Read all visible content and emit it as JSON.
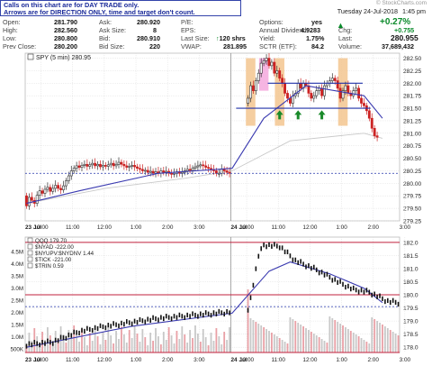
{
  "notice": {
    "line1": "Calls on this chart are for DAY TRADE only.",
    "line2": "Arrows are for DIRECTION ONLY, time and target don't count."
  },
  "header": {
    "date": "Tuesday 24-Jul-2018",
    "time": "1:45 pm",
    "watermark": "© StockCharts.com",
    "change_pct": "+0.27%"
  },
  "quote": {
    "open_label": "Open:",
    "open": "281.790",
    "high_label": "High:",
    "high": "282.560",
    "low_label": "Low:",
    "low": "280.800",
    "prev_label": "Prev Close:",
    "prev": "280.200",
    "ask_label": "Ask:",
    "ask": "280.920",
    "asksize_label": "Ask Size:",
    "asksize": "8",
    "bid_label": "Bid:",
    "bid": "280.910",
    "bidsize_label": "Bid Size:",
    "bidsize": "220",
    "pe_label": "P/E:",
    "eps_label": "EPS:",
    "lastsize_label": "Last Size:",
    "lastsize": "120 shrs",
    "vwap_label": "VWAP:",
    "vwap": "281.895",
    "options_label": "Options:",
    "options": "yes",
    "div_label": "Annual Dividend:",
    "div": "4.9283",
    "yield_label": "Yield:",
    "yield": "1.75%",
    "sctr_label": "SCTR (ETF):",
    "sctr": "84.2",
    "chg_label": "Chg:",
    "chg": "+0.755",
    "last_label": "Last:",
    "last": "280.955",
    "vol_label": "Volume:",
    "vol": "37,689,432"
  },
  "colors": {
    "up": "#333333",
    "down": "#cc2222",
    "ma": "#3a3ab0",
    "vwap": "#c9c9c9",
    "support": "#2233aa",
    "resist": "#c0203c",
    "orange": "#f3c58f",
    "pink": "#f4a8dd",
    "arrow": "#1a8a2a",
    "grid": "#dddddd"
  },
  "chart_data": [
    {
      "type": "candlestick",
      "title": "SPY (5 min) 280.95",
      "x_ticks": [
        "23 Jul",
        "10:00",
        "11:00",
        "12:00",
        "1:00",
        "2:00",
        "3:00",
        "24 Jul",
        "10:00",
        "11:00",
        "12:00",
        "1:00",
        "2:00",
        "3:00"
      ],
      "ylim": [
        279.25,
        282.6
      ],
      "y_ticks": [
        279.25,
        279.5,
        279.75,
        280.0,
        280.25,
        280.5,
        280.75,
        281.0,
        281.25,
        281.5,
        281.75,
        282.0,
        282.25,
        282.5
      ],
      "session1_closes": [
        279.55,
        279.72,
        279.66,
        279.6,
        279.76,
        279.85,
        279.8,
        279.88,
        279.92,
        279.84,
        279.9,
        279.96,
        279.9,
        279.87,
        279.95,
        280.05,
        280.15,
        280.25,
        280.3,
        280.35,
        280.32,
        280.36,
        280.38,
        280.34,
        280.37,
        280.4,
        280.35,
        280.38,
        280.33,
        280.36,
        280.34,
        280.37,
        280.4,
        280.35,
        280.38,
        280.42,
        280.38,
        280.35,
        280.32,
        280.34,
        280.36,
        280.33,
        280.3,
        280.28,
        280.25,
        280.26,
        280.22,
        280.24,
        280.2,
        280.23,
        280.2,
        280.25,
        280.22,
        280.24,
        280.2,
        280.18,
        280.2,
        280.23,
        280.2,
        280.22,
        280.25,
        280.28,
        280.26,
        280.3,
        280.33,
        280.35,
        280.37,
        280.35,
        280.32,
        280.3,
        280.27,
        280.25,
        280.2,
        280.2,
        280.28,
        280.25,
        280.22,
        280.2
      ],
      "session2_closes": [
        281.7,
        281.95,
        281.85,
        282.05,
        282.2,
        282.4,
        282.45,
        282.5,
        282.35,
        282.42,
        282.2,
        282.25,
        282.1,
        282.0,
        281.8,
        281.7,
        281.6,
        281.75,
        281.8,
        282.0,
        281.9,
        282.0,
        281.95,
        281.8,
        281.7,
        281.75,
        281.85,
        281.9,
        281.75,
        281.95,
        282.0,
        282.05,
        282.1,
        282.05,
        281.9,
        281.7,
        281.85,
        281.95,
        281.8,
        281.75,
        281.85,
        281.9,
        281.7,
        281.6,
        281.55,
        281.45,
        281.3,
        281.1,
        280.95,
        280.92
      ],
      "moving_average": [
        [
          0,
          279.6
        ],
        [
          20,
          279.85
        ],
        [
          50,
          280.2
        ],
        [
          78,
          280.3
        ],
        [
          90,
          281.3
        ],
        [
          106,
          281.95
        ],
        [
          128,
          281.75
        ],
        [
          135,
          281.3
        ]
      ],
      "vwap_line": [
        [
          0,
          279.6
        ],
        [
          30,
          279.9
        ],
        [
          60,
          280.1
        ],
        [
          78,
          280.25
        ],
        [
          100,
          280.85
        ],
        [
          128,
          281.0
        ],
        [
          135,
          280.9
        ]
      ],
      "support_level": 281.5,
      "resistance_level": 282.0,
      "prev_close_level": 280.2,
      "shaded_bars": [
        [
          85,
          "orange"
        ],
        [
          90,
          "pink"
        ],
        [
          96,
          "orange"
        ],
        [
          120,
          "orange"
        ]
      ],
      "up_arrows": [
        [
          96,
          281.35
        ],
        [
          103,
          281.35
        ],
        [
          112,
          281.35
        ]
      ]
    },
    {
      "type": "line",
      "title": "QQQ 179.70",
      "legend": [
        "$NYAD -222.00",
        "$NYUPV:$NYDNV 1.44",
        "$TICK -221.00",
        "$TRIN 0.59"
      ],
      "right_ticks": [
        178.0,
        178.5,
        179.0,
        179.5,
        180.0,
        180.5,
        181.0,
        181.5,
        182.0
      ],
      "left_ticks": [
        "500K",
        "1.0M",
        "1.5M",
        "2.0M",
        "2.5M",
        "3.0M",
        "3.5M",
        "4.0M",
        "4.5M"
      ],
      "prices": [
        [
          0,
          178.1
        ],
        [
          10,
          178.2
        ],
        [
          20,
          178.6
        ],
        [
          30,
          178.8
        ],
        [
          50,
          179.1
        ],
        [
          78,
          179.35
        ],
        [
          82,
          181.5
        ],
        [
          84,
          181.9
        ],
        [
          90,
          181.85
        ],
        [
          96,
          181.3
        ],
        [
          104,
          180.95
        ],
        [
          112,
          180.5
        ],
        [
          118,
          180.2
        ],
        [
          124,
          180.1
        ],
        [
          128,
          179.9
        ],
        [
          131,
          179.75
        ],
        [
          135,
          179.7
        ]
      ],
      "ma": [
        [
          0,
          178.0
        ],
        [
          40,
          178.8
        ],
        [
          78,
          179.3
        ],
        [
          92,
          180.9
        ],
        [
          100,
          181.25
        ],
        [
          115,
          180.8
        ],
        [
          128,
          180.25
        ],
        [
          135,
          179.7
        ]
      ],
      "resistance_level": 180.0,
      "support_level": 179.55,
      "prev_close_level": 179.6,
      "top_level": 182.0,
      "bottom_level": 177.8
    }
  ]
}
